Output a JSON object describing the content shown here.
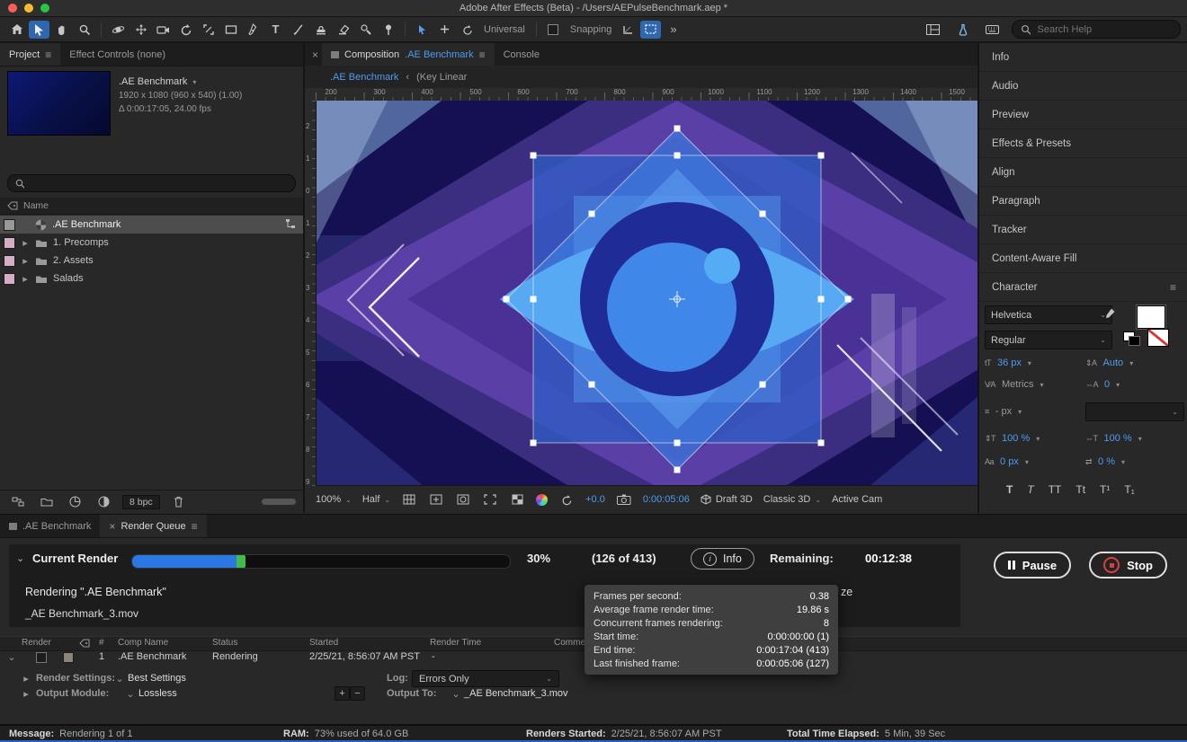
{
  "colors": {
    "accent_blue": "#4e9bf2",
    "progress_blue": "#2b78e4",
    "progress_green": "#3fbc4a",
    "stop_red": "#d84040",
    "selection_bg": "#4d4d4d",
    "active_tool_bg": "#2f66b0"
  },
  "icons": {
    "menu": "≡",
    "close": "×",
    "chevron_down": "⌄",
    "back_chevron": "‹",
    "triangle_down": "▾",
    "triangle_right": "▸",
    "overflow": "»",
    "plus": "+",
    "minus": "−",
    "info_glyph": "i",
    "type_tool": "T",
    "char_size": "tT",
    "char_leading": "⇕A",
    "char_kerning": "V∕A",
    "char_tracking": "⇔A",
    "char_stroke": "≡",
    "char_vscale": "⇕T",
    "char_hscale": "⇔T",
    "char_baseline": "Aa",
    "char_tsume": "⇄"
  },
  "titlebar": {
    "title": "Adobe After Effects (Beta) - /Users/AEPulseBenchmark.aep *"
  },
  "toolbar": {
    "universal_label": "Universal",
    "snapping_label": "Snapping",
    "search_placeholder": "Search Help"
  },
  "project": {
    "tab_project": "Project",
    "tab_effect_controls": "Effect Controls (none)",
    "comp_name": ".AE Benchmark",
    "comp_info_line1": "1920 x 1080  (960 x 540)  (1.00)",
    "comp_info_line2": "Δ 0:00:17:05, 24.00 fps",
    "name_header": "Name",
    "bpc": "8 bpc",
    "items": [
      {
        "label": ".AE Benchmark",
        "chip_style": "background:#97999b"
      },
      {
        "label": "1. Precomps",
        "chip_style": "background:#d5aec6"
      },
      {
        "label": "2. Assets",
        "chip_style": "background:#d5aec6"
      },
      {
        "label": "Salads",
        "chip_style": "background:#d5aec6"
      }
    ]
  },
  "composition": {
    "tab_composition": "Composition",
    "tab_comp_name": ".AE Benchmark",
    "tab_console": "Console",
    "breadcrumb_comp": ".AE Benchmark",
    "breadcrumb_key": "(Key Linear",
    "ruler": [
      "200",
      "300",
      "400",
      "500",
      "600",
      "700",
      "800",
      "900",
      "1000",
      "1100",
      "1200",
      "1300",
      "1400",
      "1500"
    ],
    "vruler": [
      "2",
      "1",
      "0",
      "1",
      "2",
      "3",
      "4",
      "5",
      "6",
      "7",
      "8",
      "9"
    ],
    "zoom": "100%",
    "resolution": "Half",
    "exposure": "+0.0",
    "timecode": "0:00:05:06",
    "draft_3d": "Draft 3D",
    "renderer": "Classic 3D",
    "camera": "Active Cam"
  },
  "sidebar": {
    "panels": [
      "Info",
      "Audio",
      "Preview",
      "Effects & Presets",
      "Align",
      "Paragraph",
      "Tracker",
      "Content-Aware Fill"
    ],
    "character": {
      "title": "Character",
      "font_family": "Helvetica",
      "font_style": "Regular",
      "font_size": "36 px",
      "leading": "Auto",
      "kerning": "Metrics",
      "tracking": "0",
      "stroke_width": "- px",
      "vertical_scale": "100 %",
      "horizontal_scale": "100 %",
      "baseline_shift": "0 px",
      "tsume": "0 %",
      "faux": [
        "T",
        "T",
        "TT",
        "Tt",
        "T¹",
        "T₁"
      ]
    }
  },
  "renderqueue": {
    "tab_comp": ".AE Benchmark",
    "tab_queue": "Render Queue",
    "current_label": "Current Render",
    "percent": "30%",
    "progress_style": "width:30%",
    "frames": "(126 of 413)",
    "info_label": "Info",
    "remaining_label": "Remaining:",
    "remaining_value": "00:12:38",
    "pause_label": "Pause",
    "stop_label": "Stop",
    "rendering_line": "Rendering \".AE Benchmark\"",
    "clipped_text": "ze",
    "output_file": "_AE Benchmark_3.mov",
    "tooltip": {
      "rows": [
        {
          "label": "Frames per second:",
          "value": "0.38"
        },
        {
          "label": "Average frame render time:",
          "value": "19.86 s"
        },
        {
          "label": "Concurrent frames rendering:",
          "value": "8"
        },
        {
          "label": "Start time:",
          "value": "0:00:00:00 (1)"
        },
        {
          "label": "End time:",
          "value": "0:00:17:04 (413)"
        },
        {
          "label": "Last finished frame:",
          "value": "0:00:05:06 (127)"
        }
      ]
    },
    "headers": [
      "Render",
      "#",
      "Comp Name",
      "Status",
      "Started",
      "Render Time",
      "Comment"
    ],
    "row": {
      "num": "1",
      "comp": ".AE Benchmark",
      "status": "Rendering",
      "started": "2/25/21, 8:56:07 AM PST",
      "render_time": "-"
    },
    "render_settings_label": "Render Settings:",
    "render_settings_value": "Best Settings",
    "log_label": "Log:",
    "log_value": "Errors Only",
    "output_module_label": "Output Module:",
    "output_module_value": "Lossless",
    "output_to_label": "Output To:"
  },
  "statusbar": {
    "message_label": "Message:",
    "message_value": "Rendering 1 of 1",
    "ram_label": "RAM:",
    "ram_value": "73% used of 64.0 GB",
    "renders_label": "Renders Started:",
    "renders_value": "2/25/21, 8:56:07 AM PST",
    "elapsed_label": "Total Time Elapsed:",
    "elapsed_value": "5 Min, 39 Sec"
  }
}
